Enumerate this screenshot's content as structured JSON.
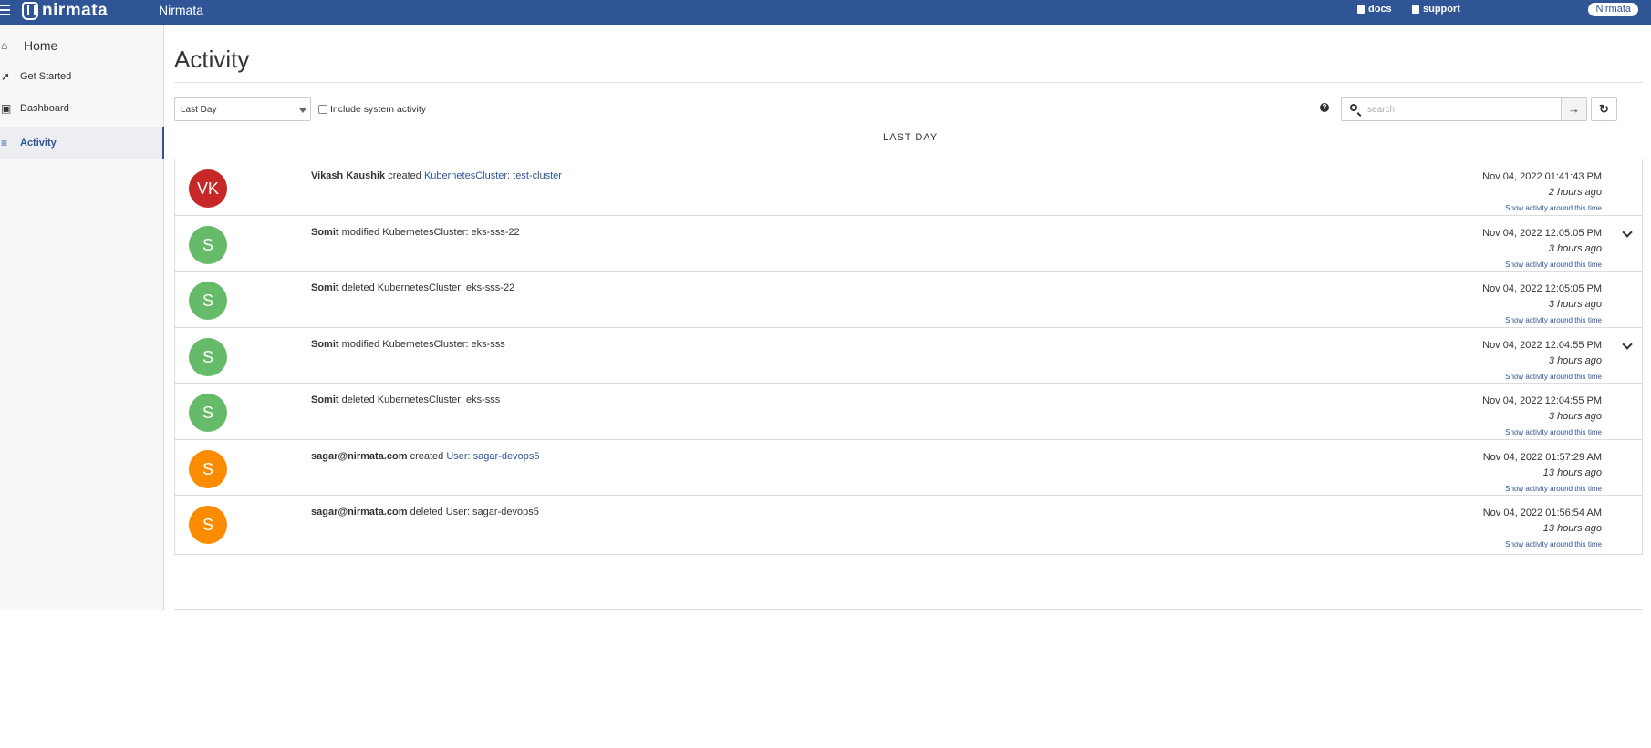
{
  "topbar": {
    "logo_text": "nirmata",
    "app_name": "Nirmata",
    "docs_label": "docs",
    "support_label": "support",
    "user_label": "Nirmata"
  },
  "sidebar": {
    "items": [
      {
        "label": "Home",
        "icon": "home-icon"
      },
      {
        "label": "Get Started",
        "icon": "rocket-icon"
      },
      {
        "label": "Dashboard",
        "icon": "dashboard-icon"
      },
      {
        "label": "Activity",
        "icon": "list-icon"
      }
    ]
  },
  "main": {
    "title": "Activity",
    "filter": {
      "selected": "Last Day"
    },
    "include_system_label": "Include system activity",
    "search": {
      "placeholder": "search"
    },
    "divider_label": "LAST DAY",
    "colors": {
      "brand": "#2f5597",
      "red": "#c62828",
      "green": "#66bb6a",
      "orange": "#fb8c00"
    },
    "activities": [
      {
        "initials": "VK",
        "color": "#c62828",
        "actor": "Vikash Kaushik",
        "verb": "created",
        "object": "KubernetesCluster: test-cluster",
        "object_link": true,
        "timestamp": "Nov 04, 2022 01:41:43 PM",
        "ago": "2 hours ago",
        "around": "Show activity around this time",
        "expandable": false
      },
      {
        "initials": "S",
        "color": "#66bb6a",
        "actor": "Somit",
        "verb": "modified",
        "object": "KubernetesCluster: eks-sss-22",
        "object_link": false,
        "timestamp": "Nov 04, 2022 12:05:05 PM",
        "ago": "3 hours ago",
        "around": "Show activity around this time",
        "expandable": true
      },
      {
        "initials": "S",
        "color": "#66bb6a",
        "actor": "Somit",
        "verb": "deleted",
        "object": "KubernetesCluster: eks-sss-22",
        "object_link": false,
        "timestamp": "Nov 04, 2022 12:05:05 PM",
        "ago": "3 hours ago",
        "around": "Show activity around this time",
        "expandable": false
      },
      {
        "initials": "S",
        "color": "#66bb6a",
        "actor": "Somit",
        "verb": "modified",
        "object": "KubernetesCluster: eks-sss",
        "object_link": false,
        "timestamp": "Nov 04, 2022 12:04:55 PM",
        "ago": "3 hours ago",
        "around": "Show activity around this time",
        "expandable": true
      },
      {
        "initials": "S",
        "color": "#66bb6a",
        "actor": "Somit",
        "verb": "deleted",
        "object": "KubernetesCluster: eks-sss",
        "object_link": false,
        "timestamp": "Nov 04, 2022 12:04:55 PM",
        "ago": "3 hours ago",
        "around": "Show activity around this time",
        "expandable": false
      },
      {
        "initials": "S",
        "color": "#fb8c00",
        "actor": "sagar@nirmata.com",
        "verb": "created",
        "object": "User: sagar-devops5",
        "object_link": true,
        "timestamp": "Nov 04, 2022 01:57:29 AM",
        "ago": "13 hours ago",
        "around": "Show activity around this time",
        "expandable": false
      },
      {
        "initials": "S",
        "color": "#fb8c00",
        "actor": "sagar@nirmata.com",
        "verb": "deleted",
        "object": "User: sagar-devops5",
        "object_link": false,
        "timestamp": "Nov 04, 2022 01:56:54 AM",
        "ago": "13 hours ago",
        "around": "Show activity around this time",
        "expandable": false
      }
    ]
  }
}
